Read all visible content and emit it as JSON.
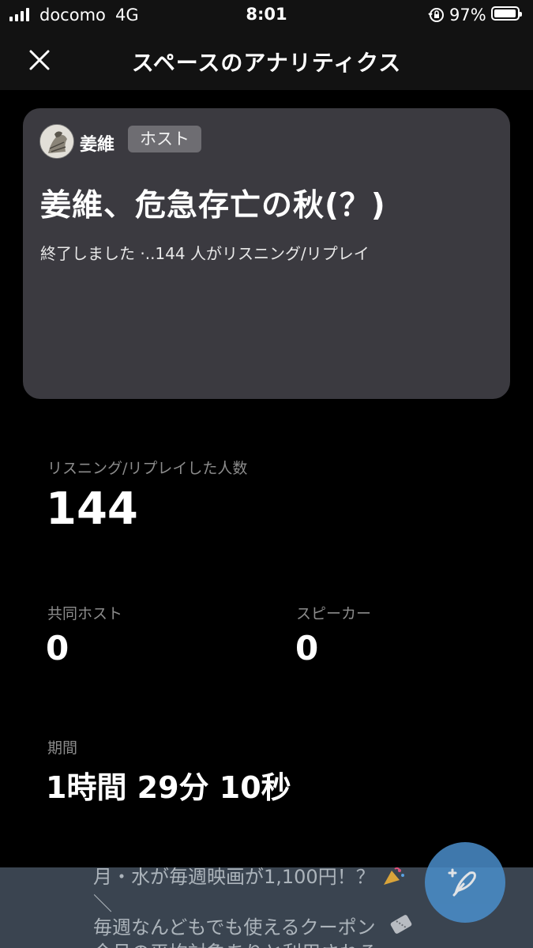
{
  "status_bar": {
    "carrier": "docomo",
    "network": "4G",
    "time": "8:01",
    "battery": "97%"
  },
  "header": {
    "title": "スペースのアナリティクス"
  },
  "space": {
    "host_name": "姜維",
    "host_badge": "ホスト",
    "title": "姜維、危急存亡の秋(？)",
    "status": "終了しました ·..144 人がリスニング/リプレイ"
  },
  "stats": {
    "listeners_label": "リスニング/リプレイした人数",
    "listeners_value": "144",
    "cohosts_label": "共同ホスト",
    "cohosts_value": "0",
    "speakers_label": "スピーカー",
    "speakers_value": "0",
    "duration_label": "期間",
    "duration_value": "1時間 29分 10秒"
  },
  "background_tweet": {
    "line1": "月・水が毎週映画が1,100円！？",
    "line2": "＼",
    "line3": "毎週なんどもでも使えるクーポン",
    "line4": "今月の平均対象ありと利用される"
  },
  "colors": {
    "card": "#3b3a40",
    "compose_button": "#4a8ecb"
  }
}
